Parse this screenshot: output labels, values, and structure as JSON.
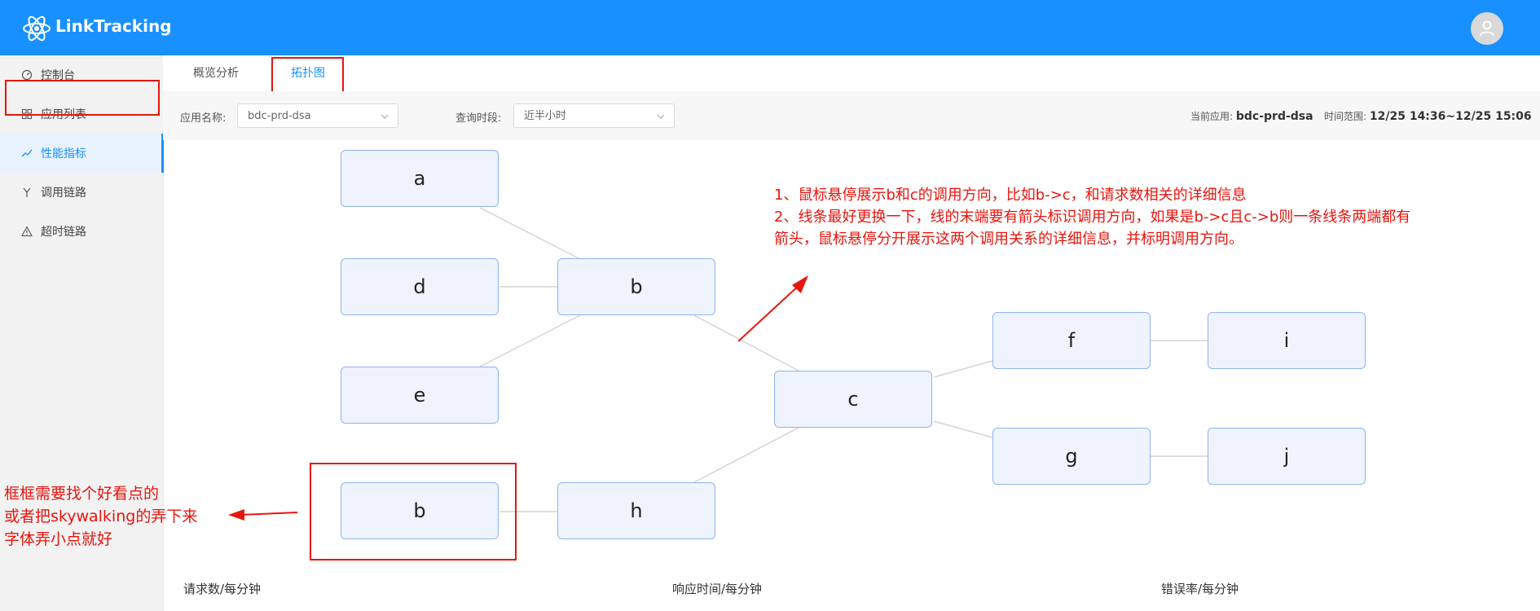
{
  "app": {
    "title": "LinkTracking"
  },
  "header": {
    "avatar_icon": "user-icon"
  },
  "sidebar": {
    "items": [
      {
        "label": "控制台",
        "icon": "dashboard-icon"
      },
      {
        "label": "应用列表",
        "icon": "grid-icon"
      },
      {
        "label": "性能指标",
        "icon": "trend-icon",
        "active": true
      },
      {
        "label": "调用链路",
        "icon": "branch-icon"
      },
      {
        "label": "超时链路",
        "icon": "warning-icon"
      }
    ]
  },
  "tabs": [
    {
      "label": "概览分析"
    },
    {
      "label": "拓扑图",
      "active": true
    }
  ],
  "filters": {
    "app_label": "应用名称:",
    "app_value": "bdc-prd-dsa",
    "period_label": "查询时段:",
    "period_value": "近半小时"
  },
  "meta": {
    "current_app_label": "当前应用:",
    "current_app_value": "bdc-prd-dsa",
    "time_range_label": "时间范围:",
    "time_range_value": "12/25 14:36~12/25 15:06"
  },
  "graph": {
    "nodes": [
      {
        "id": "a1",
        "label": "a"
      },
      {
        "id": "d1",
        "label": "d"
      },
      {
        "id": "e1",
        "label": "e"
      },
      {
        "id": "b1",
        "label": "b"
      },
      {
        "id": "b2",
        "label": "b"
      },
      {
        "id": "h1",
        "label": "h"
      },
      {
        "id": "c1",
        "label": "c"
      },
      {
        "id": "f1",
        "label": "f"
      },
      {
        "id": "g1",
        "label": "g"
      },
      {
        "id": "i1",
        "label": "i"
      },
      {
        "id": "j1",
        "label": "j"
      }
    ]
  },
  "annotations": {
    "right_note": [
      "1、鼠标悬停展示b和c的调用方向，比如b->c，和请求数相关的详细信息",
      "2、线条最好更换一下，线的末端要有箭头标识调用方向，如果是b->c且c->b则一条线条两端都有",
      "箭头，鼠标悬停分开展示这两个调用关系的详细信息，并标明调用方向。"
    ],
    "left_note": [
      "框框需要找个好看点的",
      "或者把skywalking的弄下来",
      "字体弄小点就好"
    ]
  },
  "bottom": {
    "labels": [
      "请求数/每分钟",
      "响应时间/每分钟",
      "错误率/每分钟"
    ]
  },
  "colors": {
    "brand": "#1890ff",
    "annotation": "#e8150d",
    "node_fill": "#eef3fd",
    "node_border": "#8eb3f3"
  }
}
